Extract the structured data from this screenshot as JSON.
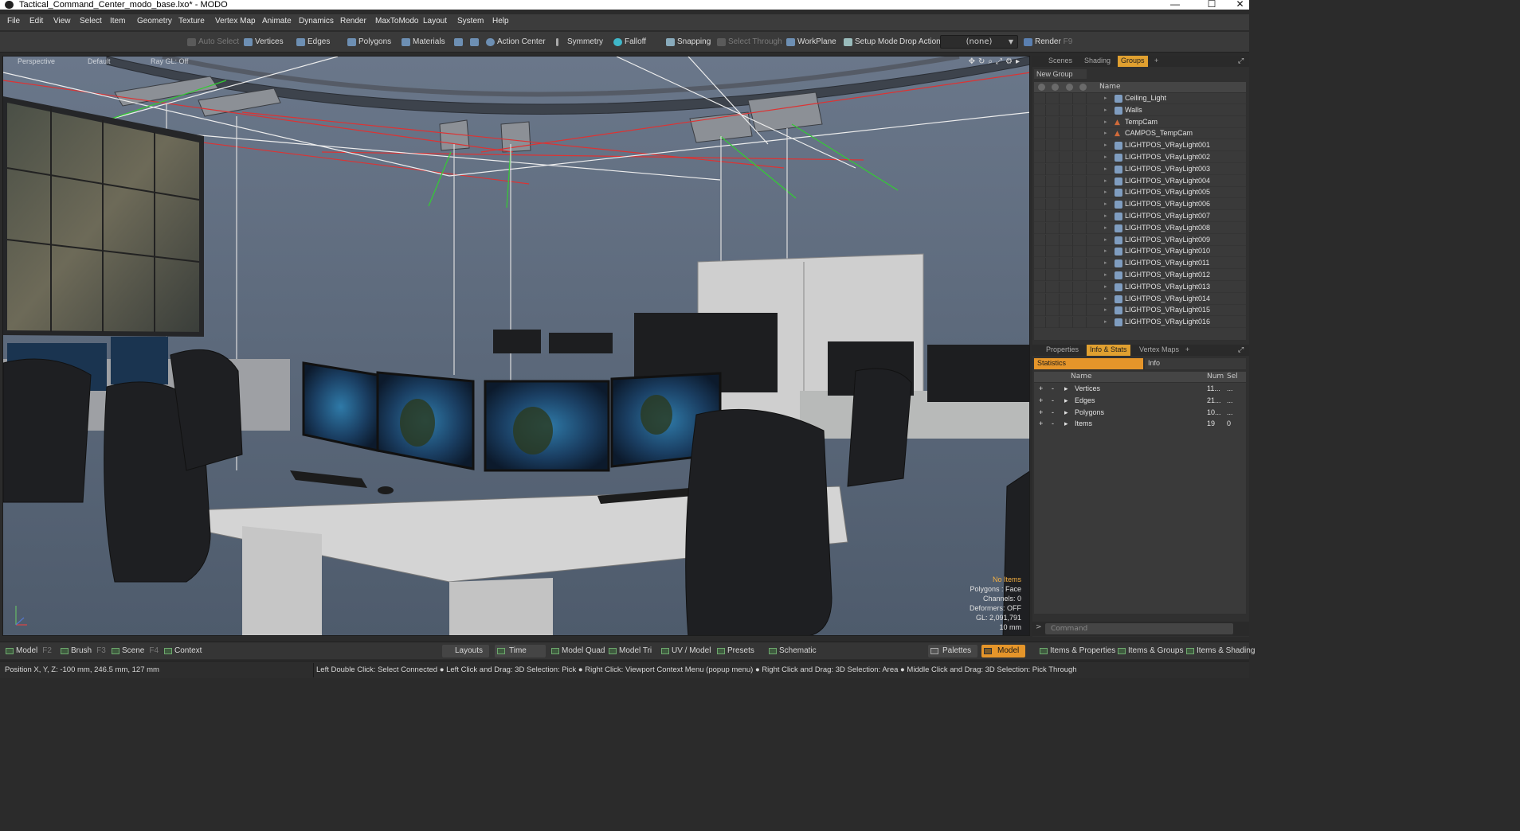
{
  "window": {
    "title": "Tactical_Command_Center_modo_base.lxo* - MODO",
    "minimize": "—",
    "maximize": "☐",
    "close": "✕"
  },
  "menu": [
    "File",
    "Edit",
    "View",
    "Select",
    "Item",
    "Geometry",
    "Texture",
    "Vertex Map",
    "Animate",
    "Dynamics",
    "Render",
    "MaxToModo",
    "Layout",
    "System",
    "Help"
  ],
  "toolbar": {
    "auto_select": "Auto Select",
    "vertices": "Vertices",
    "edges": "Edges",
    "polygons": "Polygons",
    "materials": "Materials",
    "action_center": "Action Center",
    "symmetry": "Symmetry",
    "falloff": "Falloff",
    "snapping": "Snapping",
    "select_through": "Select Through",
    "workplane": "WorkPlane",
    "setup_mode": "Setup Mode",
    "drop_action_label": "Drop Action",
    "drop_action_value": "(none)",
    "render": "Render",
    "render_key": "F9"
  },
  "viewport": {
    "view": "Perspective",
    "style": "Default",
    "raygl": "Ray GL: Off",
    "info": {
      "selection": "No Items",
      "polygons": "Polygons : Face",
      "channels": "Channels: 0",
      "deformers": "Deformers: OFF",
      "gl": "GL: 2,091,791",
      "scale": "10 mm"
    }
  },
  "scene_tabs": {
    "scenes": "Scenes",
    "shading": "Shading",
    "groups": "Groups",
    "add": "+"
  },
  "groups": {
    "new_group": "New Group",
    "name_header": "Name",
    "items": [
      {
        "label": "Ceiling_Light",
        "type": "mesh"
      },
      {
        "label": "Walls",
        "type": "mesh"
      },
      {
        "label": "TempCam",
        "type": "camera"
      },
      {
        "label": "CAMPOS_TempCam",
        "type": "camera"
      },
      {
        "label": "LIGHTPOS_VRayLight001",
        "type": "mesh"
      },
      {
        "label": "LIGHTPOS_VRayLight002",
        "type": "mesh"
      },
      {
        "label": "LIGHTPOS_VRayLight003",
        "type": "mesh"
      },
      {
        "label": "LIGHTPOS_VRayLight004",
        "type": "mesh"
      },
      {
        "label": "LIGHTPOS_VRayLight005",
        "type": "mesh"
      },
      {
        "label": "LIGHTPOS_VRayLight006",
        "type": "mesh"
      },
      {
        "label": "LIGHTPOS_VRayLight007",
        "type": "mesh"
      },
      {
        "label": "LIGHTPOS_VRayLight008",
        "type": "mesh"
      },
      {
        "label": "LIGHTPOS_VRayLight009",
        "type": "mesh"
      },
      {
        "label": "LIGHTPOS_VRayLight010",
        "type": "mesh"
      },
      {
        "label": "LIGHTPOS_VRayLight011",
        "type": "mesh"
      },
      {
        "label": "LIGHTPOS_VRayLight012",
        "type": "mesh"
      },
      {
        "label": "LIGHTPOS_VRayLight013",
        "type": "mesh"
      },
      {
        "label": "LIGHTPOS_VRayLight014",
        "type": "mesh"
      },
      {
        "label": "LIGHTPOS_VRayLight015",
        "type": "mesh"
      },
      {
        "label": "LIGHTPOS_VRayLight016",
        "type": "mesh"
      }
    ]
  },
  "props_tabs": {
    "properties": "Properties",
    "info_stats": "Info & Stats",
    "vertex_maps": "Vertex Maps",
    "add": "+"
  },
  "stats": {
    "tab_statistics": "Statistics",
    "tab_info": "Info",
    "headers": {
      "name": "Name",
      "num": "Num",
      "sel": "Sel"
    },
    "rows": [
      {
        "name": "Vertices",
        "num": "11...",
        "sel": "..."
      },
      {
        "name": "Edges",
        "num": "21...",
        "sel": "..."
      },
      {
        "name": "Polygons",
        "num": "10...",
        "sel": "..."
      },
      {
        "name": "Items",
        "num": "19",
        "sel": "0"
      }
    ]
  },
  "command": {
    "placeholder": "Command"
  },
  "bottombar": {
    "model": "Model",
    "model_key": "F2",
    "brush": "Brush",
    "brush_key": "F3",
    "scene": "Scene",
    "scene_key": "F4",
    "context": "Context",
    "layouts": "Layouts",
    "time": "Time",
    "model_quad": "Model Quad",
    "model_tri": "Model Tri",
    "uv_model": "UV / Model",
    "presets": "Presets",
    "schematic": "Schematic",
    "palettes": "Palettes",
    "model_active": "Model",
    "items_properties": "Items & Properties",
    "items_groups": "Items & Groups",
    "items_shading": "Items & Shading"
  },
  "statusbar": {
    "position": "Position X, Y, Z:   -100 mm, 246.5 mm, 127 mm",
    "hint": "Left Double Click: Select Connected ● Left Click and Drag: 3D Selection: Pick ● Right Click: Viewport Context Menu (popup menu) ● Right Click and Drag: 3D Selection: Area ● Middle Click and Drag: 3D Selection: Pick Through"
  },
  "colors": {
    "accent": "#e5952a",
    "viewport_bg": "#59667a",
    "panel": "#3a3a3a"
  }
}
